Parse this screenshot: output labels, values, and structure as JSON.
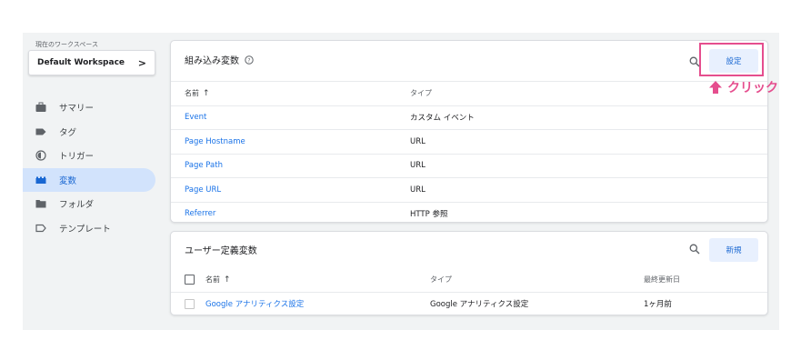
{
  "sidebar": {
    "workspace_label": "現在のワークスペース",
    "workspace_name": "Default Workspace",
    "workspace_chevron": ">",
    "items": [
      {
        "label": "サマリー",
        "icon": "briefcase-icon",
        "active": false
      },
      {
        "label": "タグ",
        "icon": "tag-icon",
        "active": false
      },
      {
        "label": "トリガー",
        "icon": "trigger-icon",
        "active": false
      },
      {
        "label": "変数",
        "icon": "variables-icon",
        "active": true
      },
      {
        "label": "フォルダ",
        "icon": "folder-icon",
        "active": false
      },
      {
        "label": "テンプレート",
        "icon": "template-icon",
        "active": false
      }
    ]
  },
  "builtin": {
    "title": "組み込み変数",
    "help_icon": "help-icon",
    "search_icon": "search-icon",
    "button_label": "設定",
    "columns": {
      "name": "名前",
      "sort_arrow": "↑",
      "type": "タイプ"
    },
    "rows": [
      {
        "name": "Event",
        "type": "カスタム イベント"
      },
      {
        "name": "Page Hostname",
        "type": "URL"
      },
      {
        "name": "Page Path",
        "type": "URL"
      },
      {
        "name": "Page URL",
        "type": "URL"
      },
      {
        "name": "Referrer",
        "type": "HTTP 参照"
      }
    ]
  },
  "user_defined": {
    "title": "ユーザー定義変数",
    "search_icon": "search-icon",
    "button_label": "新規",
    "columns": {
      "name": "名前",
      "sort_arrow": "↑",
      "type": "タイプ",
      "updated": "最終更新日"
    },
    "rows": [
      {
        "name": "Google アナリティクス設定",
        "type": "Google アナリティクス設定",
        "updated": "1ヶ月前"
      }
    ]
  },
  "annotation": {
    "text": "クリック",
    "color": "#e54e8e",
    "icon": "arrow-up-icon"
  },
  "colors": {
    "accent": "#1a73e8",
    "active_nav_bg": "#d2e3fc",
    "panel_bg": "#f1f3f4"
  }
}
